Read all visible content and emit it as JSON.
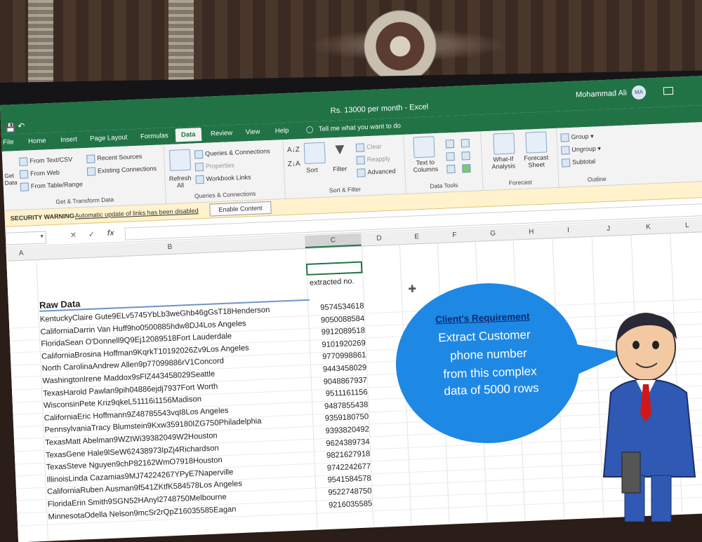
{
  "window": {
    "title": "Rs. 13000 per month  -  Excel",
    "user_name": "Mohammad Ali",
    "user_initials": "MA"
  },
  "tabs": [
    "File",
    "Home",
    "Insert",
    "Page Layout",
    "Formulas",
    "Data",
    "Review",
    "View",
    "Help"
  ],
  "active_tab": "Data",
  "tell_me": "Tell me what you want to do",
  "ribbon": {
    "get_transform": {
      "get_data": "Get\nData",
      "from_text": "From Text/CSV",
      "from_web": "From Web",
      "from_table": "From Table/Range",
      "recent_sources": "Recent Sources",
      "existing_connections": "Existing Connections",
      "label": "Get & Transform Data"
    },
    "queries": {
      "refresh_all": "Refresh All",
      "queries_connections": "Queries & Connections",
      "properties": "Properties",
      "workbook_links": "Workbook Links",
      "label": "Queries & Connections"
    },
    "sort_filter": {
      "sort": "Sort",
      "filter": "Filter",
      "clear": "Clear",
      "reapply": "Reapply",
      "advanced": "Advanced",
      "label": "Sort & Filter"
    },
    "data_tools": {
      "text_to_columns": "Text to Columns",
      "label": "Data Tools"
    },
    "forecast": {
      "what_if": "What-If Analysis",
      "forecast_sheet": "Forecast Sheet",
      "label": "Forecast"
    },
    "outline": {
      "group": "Group",
      "ungroup": "Ungroup",
      "subtotal": "Subtotal",
      "label": "Outline"
    }
  },
  "security_bar": {
    "warning": "SECURITY WARNING",
    "message": "Automatic update of links has been disabled",
    "button": "Enable Content"
  },
  "formula_bar": {
    "fx": "fx"
  },
  "columns": [
    "A",
    "B",
    "C",
    "D",
    "E",
    "F",
    "G",
    "H",
    "I",
    "J",
    "K",
    "L"
  ],
  "sheet": {
    "header_b": "Raw Data",
    "header_c": "extracted no.",
    "rows": [
      {
        "raw": "KentuckyClaire Gute9ELv5745YbLb3weGhb46gGsT18Henderson",
        "num": "9574534618"
      },
      {
        "raw": "CaliforniaDarrin Van Huff9ho0500885hdw8DJ4Los Angeles",
        "num": "9050088584"
      },
      {
        "raw": "FloridaSean O'Donnell9Q9Ej12089518Fort Lauderdale",
        "num": "9912089518"
      },
      {
        "raw": "CaliforniaBrosina Hoffman9KqrkT10192026Zv9Los Angeles",
        "num": "9101920269"
      },
      {
        "raw": "North CarolinaAndrew Allen9p77099886rV1Concord",
        "num": "9770998861"
      },
      {
        "raw": "WashingtonIrene Maddox9sFlZ443458029Seattle",
        "num": "9443458029"
      },
      {
        "raw": "TexasHarold Pawlan9pih04886ejdj7937Fort Worth",
        "num": "9048867937"
      },
      {
        "raw": "WisconsinPete Kriz9qkeL51116i1156Madison",
        "num": "9511161156"
      },
      {
        "raw": "CaliforniaEric Hoffmann9Z48785543vqI8Los Angeles",
        "num": "9487855438"
      },
      {
        "raw": "PennsylvaniaTracy Blumstein9Kxw359180IZG750Philadelphia",
        "num": "9359180750"
      },
      {
        "raw": "TexasMatt Abelman9WZtWi39382049W2Houston",
        "num": "9393820492"
      },
      {
        "raw": "TexasGene Hale9lSeW62438973IpZj4Richardson",
        "num": "9624389734"
      },
      {
        "raw": "TexasSteve Nguyen9chP82162WmO7918Houston",
        "num": "9821627918"
      },
      {
        "raw": "IllinoisLinda Cazamias9MJ74224267YPyE7Naperville",
        "num": "9742242677"
      },
      {
        "raw": "CaliforniaRuben Ausman9f541ZKtfK584578Los Angeles",
        "num": "9541584578"
      },
      {
        "raw": "FloridaErin Smith9SGN52HAnyl2748750Melbourne",
        "num": "9522748750"
      },
      {
        "raw": "MinnesotaOdella Nelson9mcSr2rQpZ16035585Eagan",
        "num": "9216035585"
      }
    ]
  },
  "overlay": {
    "title": "Client's Requirement",
    "lines": [
      "Extract Customer",
      "phone number",
      "from this complex",
      "data of 5000 rows"
    ],
    "bubble_color": "#1e88e5"
  },
  "colors": {
    "excel_green": "#217346",
    "security_bar": "#fff2cc"
  }
}
